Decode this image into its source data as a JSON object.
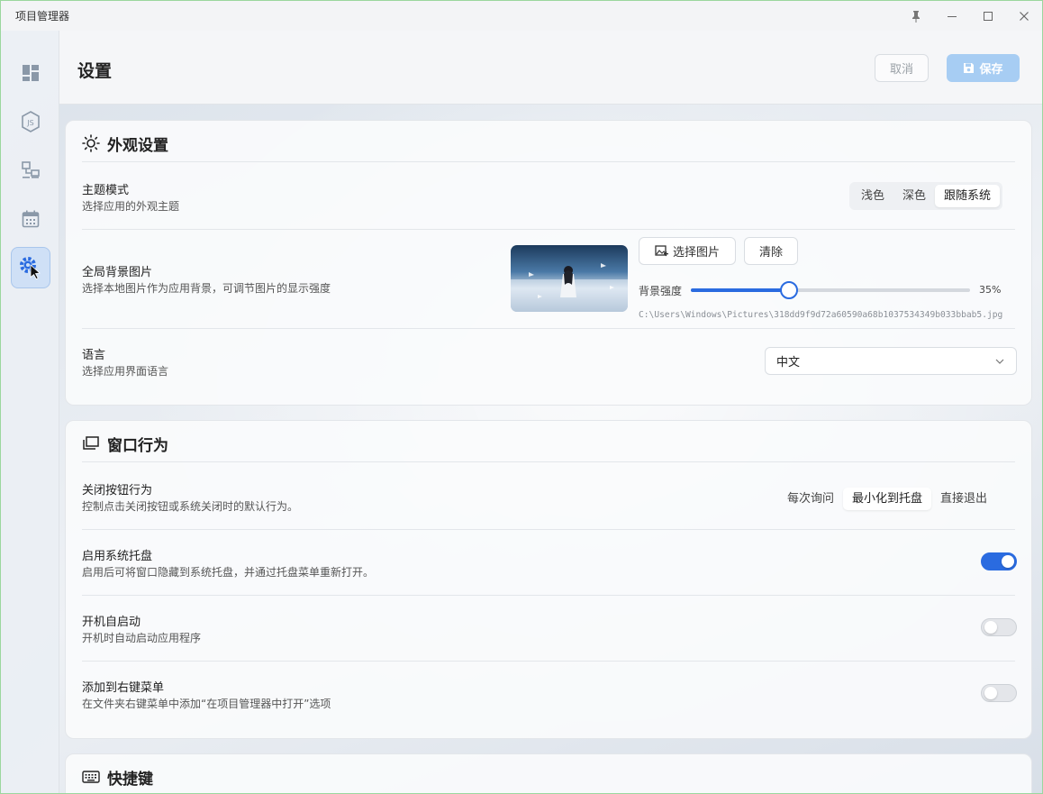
{
  "window": {
    "title": "项目管理器"
  },
  "colors": {
    "accent": "#2a6be0",
    "save_button_disabled": "#a7cdf3",
    "active_nav": "#cfe0f6"
  },
  "sidebar": {
    "items": [
      {
        "name": "dashboard",
        "icon": "dashboard-icon",
        "active": false
      },
      {
        "name": "nodejs",
        "icon": "nodejs-icon",
        "active": false
      },
      {
        "name": "remote",
        "icon": "network-icon",
        "active": false
      },
      {
        "name": "calendar",
        "icon": "calendar-icon",
        "active": false
      },
      {
        "name": "settings",
        "icon": "gear-icon",
        "active": true
      }
    ]
  },
  "header": {
    "title": "设置",
    "cancel_label": "取消",
    "save_label": "保存"
  },
  "appearance": {
    "title": "外观设置",
    "theme": {
      "title": "主题模式",
      "desc": "选择应用的外观主题",
      "options": [
        "浅色",
        "深色",
        "跟随系统"
      ],
      "selected": "跟随系统"
    },
    "background": {
      "title": "全局背景图片",
      "desc": "选择本地图片作为应用背景，可调节图片的显示强度",
      "choose_label": "选择图片",
      "clear_label": "清除",
      "intensity_label": "背景强度",
      "intensity_value": 0.35,
      "intensity_text": "35%",
      "path": "C:\\Users\\Windows\\Pictures\\318dd9f9d72a60590a68b1037534349b033bbab5.jpg"
    },
    "language": {
      "title": "语言",
      "desc": "选择应用界面语言",
      "value": "中文"
    }
  },
  "window_behavior": {
    "title": "窗口行为",
    "close_action": {
      "title": "关闭按钮行为",
      "desc": "控制点击关闭按钮或系统关闭时的默认行为。",
      "options": [
        "每次询问",
        "最小化到托盘",
        "直接退出"
      ],
      "selected": "最小化到托盘"
    },
    "tray": {
      "title": "启用系统托盘",
      "desc": "启用后可将窗口隐藏到系统托盘，并通过托盘菜单重新打开。",
      "on": true
    },
    "autostart": {
      "title": "开机自启动",
      "desc": "开机时自动启动应用程序",
      "on": false
    },
    "context_menu": {
      "title": "添加到右键菜单",
      "desc": "在文件夹右键菜单中添加“在项目管理器中打开”选项",
      "on": false
    }
  },
  "shortcuts": {
    "title": "快捷键"
  }
}
